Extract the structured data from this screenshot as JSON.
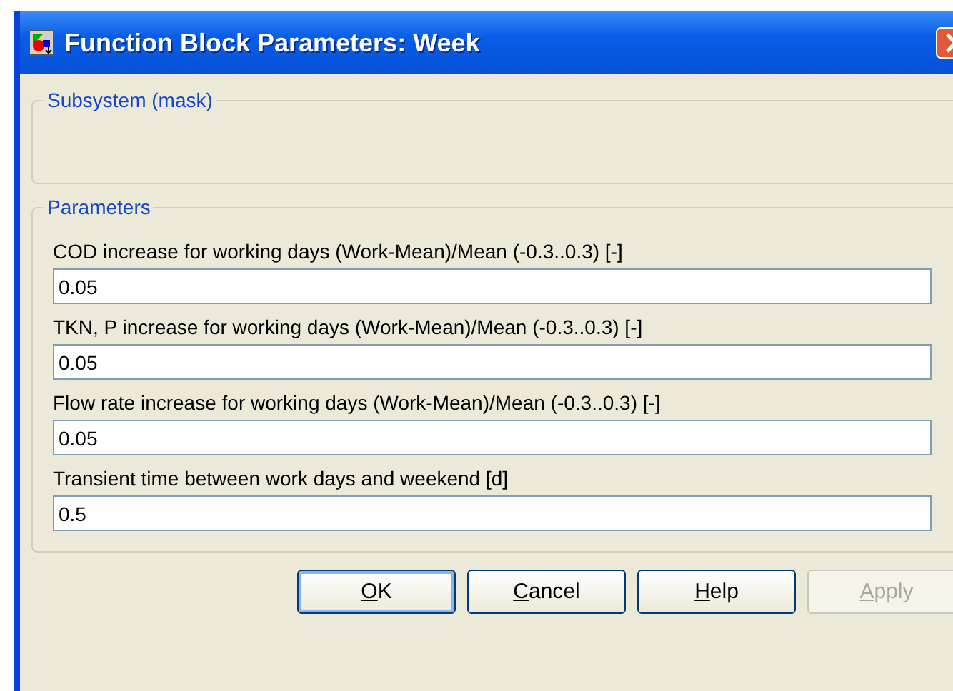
{
  "window": {
    "title": "Function Block Parameters: Week"
  },
  "mask_group": {
    "title": "Subsystem (mask)"
  },
  "parameters_group": {
    "title": "Parameters",
    "fields": [
      {
        "label": "COD increase for working days (Work-Mean)/Mean (-0.3..0.3) [-]",
        "value": "0.05"
      },
      {
        "label": "TKN, P increase for working days (Work-Mean)/Mean (-0.3..0.3) [-]",
        "value": "0.05"
      },
      {
        "label": "Flow rate increase for working days (Work-Mean)/Mean (-0.3..0.3) [-]",
        "value": "0.05"
      },
      {
        "label": "Transient time between work days and weekend [d]",
        "value": "0.5"
      }
    ]
  },
  "buttons": [
    {
      "label": "OK",
      "disabled": false,
      "default": true
    },
    {
      "label": "Cancel",
      "disabled": false,
      "default": false
    },
    {
      "label": "Help",
      "disabled": false,
      "default": false
    },
    {
      "label": "Apply",
      "disabled": true,
      "default": false
    }
  ]
}
